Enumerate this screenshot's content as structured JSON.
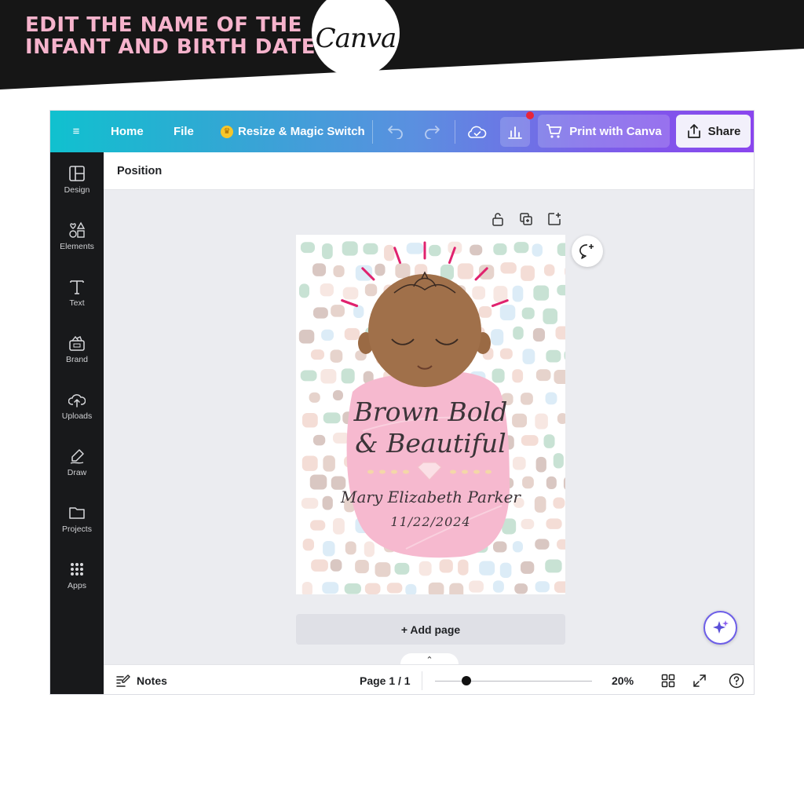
{
  "promo": {
    "headline": "EDIT THE NAME OF THE INFANT AND BIRTH DATE",
    "logo_text": "Canva",
    "banner_color": "#161616",
    "headline_color": "#f6b3cc"
  },
  "topbar": {
    "menu_icon": "hamburger-icon",
    "home": "Home",
    "file": "File",
    "resize": "Resize & Magic Switch",
    "undo_icon": "undo-icon",
    "redo_icon": "redo-icon",
    "cloud_icon": "cloud-saved-icon",
    "stats_icon": "bar-chart-icon",
    "print": "Print with Canva",
    "share": "Share",
    "gradient_colors": [
      "#10c1cf",
      "#5b8fe0",
      "#8a45ee"
    ]
  },
  "sidebar": {
    "items": [
      {
        "label": "Design",
        "icon": "design-icon"
      },
      {
        "label": "Elements",
        "icon": "elements-icon"
      },
      {
        "label": "Text",
        "icon": "text-icon"
      },
      {
        "label": "Brand",
        "icon": "brand-icon"
      },
      {
        "label": "Uploads",
        "icon": "upload-cloud-icon"
      },
      {
        "label": "Draw",
        "icon": "draw-icon"
      },
      {
        "label": "Projects",
        "icon": "folder-icon"
      },
      {
        "label": "Apps",
        "icon": "apps-grid-icon"
      }
    ]
  },
  "context_bar": {
    "position": "Position"
  },
  "card": {
    "headline_1": "Brown Bold",
    "headline_2": "& Beautiful",
    "name": "Mary Elizabeth Parker",
    "date": "11/22/2024",
    "swaddle_color": "#f6b9cf",
    "skin_color": "#a0704a",
    "ray_color": "#e0226e"
  },
  "canvas": {
    "add_page": "+ Add page"
  },
  "bottombar": {
    "notes": "Notes",
    "page_info": "Page 1 / 1",
    "zoom": "20%",
    "zoom_level": 0.2
  }
}
